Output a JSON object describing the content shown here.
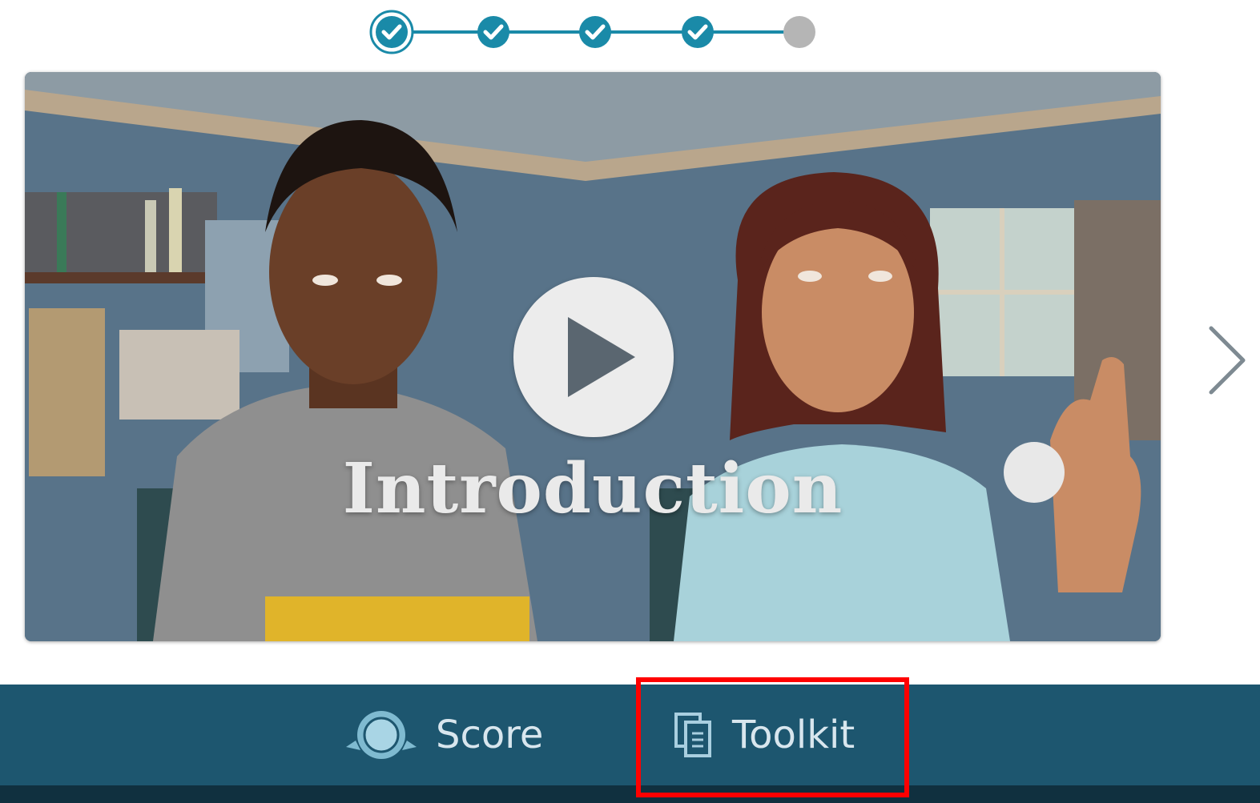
{
  "progress": {
    "steps_total": 5,
    "steps_completed": 4,
    "current_step": 1,
    "colors": {
      "complete": "#1a8aa8",
      "incomplete": "#b5b5b5",
      "line": "#1a8aa8"
    }
  },
  "video": {
    "title": "Introduction",
    "play_icon": "play-icon"
  },
  "navigation": {
    "next_icon": "chevron-right-icon"
  },
  "bottom_nav": {
    "score_label": "Score",
    "score_icon": "badge-icon",
    "toolkit_label": "Toolkit",
    "toolkit_icon": "documents-icon",
    "background": "#1d566f",
    "highlight_color": "#ff0000"
  }
}
